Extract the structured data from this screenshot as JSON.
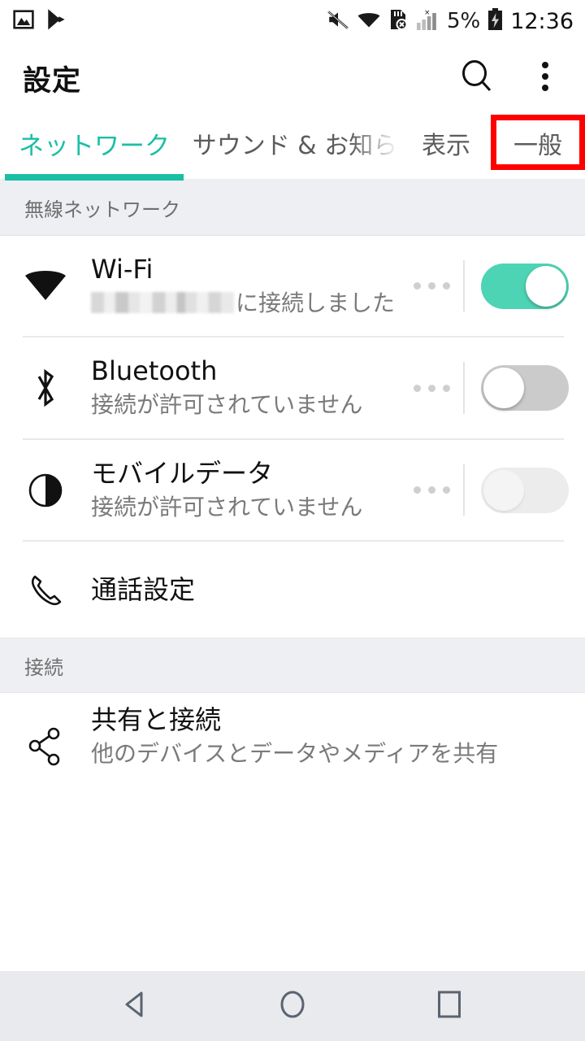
{
  "status_bar": {
    "left_icons": [
      "image-icon",
      "play-store-icon"
    ],
    "right_icons": [
      "mute-icon",
      "wifi-icon",
      "sd-card-error-icon",
      "signal-bars-icon"
    ],
    "battery_percent": "5%",
    "battery_icon": "battery-charging-icon",
    "time": "12:36"
  },
  "header": {
    "title": "設定",
    "search_icon": "search-icon",
    "overflow_icon": "more-vertical-icon"
  },
  "tabs": {
    "items": [
      {
        "label": "ネットワーク",
        "active": true
      },
      {
        "label": "サウンド & お知ら",
        "active": false
      },
      {
        "label": "表示",
        "active": false
      },
      {
        "label": "一般",
        "active": false
      }
    ],
    "active_color": "#1ABFA5",
    "highlight_color": "#FF0000",
    "highlighted_tab": "一般"
  },
  "sections": [
    {
      "header": "無線ネットワーク",
      "rows": [
        {
          "icon": "wifi-icon",
          "title": "Wi-Fi",
          "subtitle_redacted": true,
          "subtitle_suffix": "に接続しました",
          "has_dots": true,
          "toggle": "on"
        },
        {
          "icon": "bluetooth-icon",
          "title": "Bluetooth",
          "subtitle": "接続が許可されていません",
          "has_dots": true,
          "toggle": "off"
        },
        {
          "icon": "mobile-data-icon",
          "title": "モバイルデータ",
          "subtitle": "接続が許可されていません",
          "has_dots": true,
          "toggle": "disabled"
        },
        {
          "icon": "phone-icon",
          "title": "通話設定",
          "subtitle": "",
          "has_dots": false,
          "toggle": "none"
        }
      ]
    },
    {
      "header": "接続",
      "rows": [
        {
          "icon": "share-icon",
          "title": "共有と接続",
          "subtitle": "他のデバイスとデータやメディアを共有",
          "has_dots": false,
          "toggle": "none"
        }
      ]
    }
  ],
  "nav_bar": {
    "back_icon": "back-triangle-icon",
    "home_icon": "home-circle-icon",
    "recents_icon": "recents-square-icon"
  },
  "colors": {
    "accent_teal": "#1ABFA5",
    "toggle_on": "#4DD4B4",
    "section_bg": "#EDEFF2",
    "nav_bg": "#E8EAED",
    "highlight_red": "#FF0000"
  }
}
